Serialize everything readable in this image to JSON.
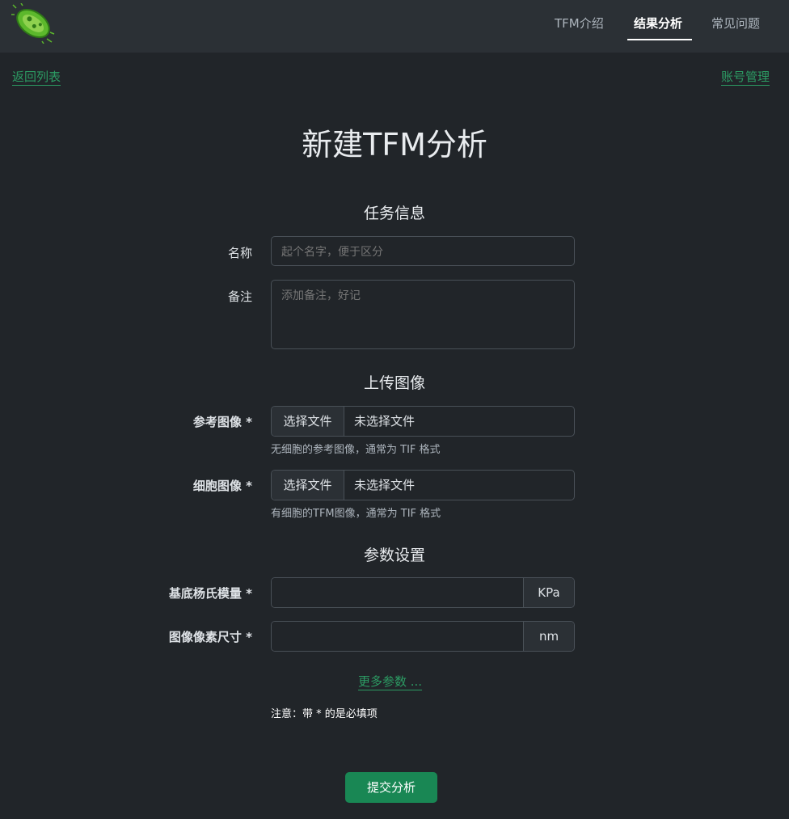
{
  "nav": {
    "items": [
      "TFM介绍",
      "结果分析",
      "常见问题"
    ],
    "active": "结果分析"
  },
  "links": {
    "back": "返回列表",
    "account": "账号管理",
    "more_params": "更多参数 ..."
  },
  "page_title": "新建TFM分析",
  "sections": {
    "task_info": "任务信息",
    "upload": "上传图像",
    "params": "参数设置"
  },
  "fields": {
    "name": {
      "label": "名称",
      "placeholder": "起个名字，便于区分"
    },
    "note": {
      "label": "备注",
      "placeholder": "添加备注，好记"
    },
    "reference_image": {
      "label": "参考图像 *",
      "button": "选择文件",
      "value": "未选择文件",
      "help": "无细胞的参考图像，通常为 TIF 格式"
    },
    "cell_image": {
      "label": "细胞图像 *",
      "button": "选择文件",
      "value": "未选择文件",
      "help": "有细胞的TFM图像，通常为 TIF 格式"
    },
    "youngs_modulus": {
      "label": "基底杨氏模量 *",
      "unit": "KPa"
    },
    "pixel_size": {
      "label": "图像像素尺寸 *",
      "unit": "nm"
    }
  },
  "note_text": "注意：带 * 的是必填项",
  "submit_label": "提交分析",
  "colors": {
    "background": "#212529",
    "navbar": "#2b3035",
    "link_green": "#2c9b63",
    "button_green": "#198754"
  },
  "icons": {
    "logo": "bacterium-icon"
  }
}
